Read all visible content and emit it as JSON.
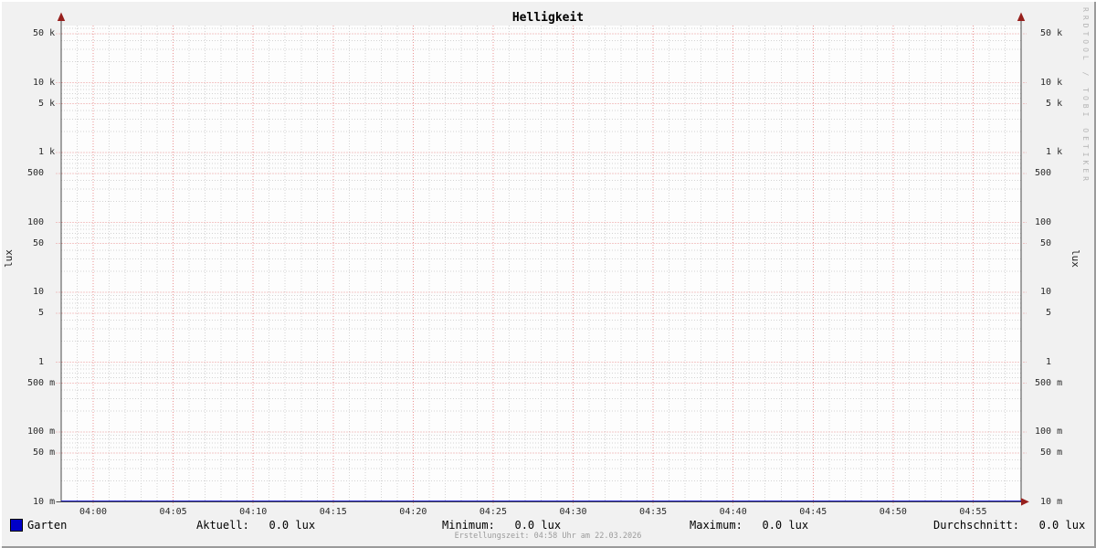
{
  "title": "Helligkeit",
  "watermark": "RRDTOOL / TOBI OETIKER",
  "chart_data": {
    "type": "line",
    "title": "Helligkeit",
    "ylabel_left": "lux",
    "ylabel_right": "lux",
    "yscale": "log",
    "ylim": [
      0.01,
      60000
    ],
    "grid": "minor gray dotted + major red dotted, on",
    "legend_position": "bottom",
    "y_ticks": [
      {
        "value": 50000,
        "label": " 50 k"
      },
      {
        "value": 10000,
        "label": " 10 k"
      },
      {
        "value": 5000,
        "label": "  5 k"
      },
      {
        "value": 1000,
        "label": "  1 k"
      },
      {
        "value": 500,
        "label": "500"
      },
      {
        "value": 100,
        "label": "100"
      },
      {
        "value": 50,
        "label": " 50"
      },
      {
        "value": 10,
        "label": " 10"
      },
      {
        "value": 5,
        "label": "  5"
      },
      {
        "value": 1,
        "label": "  1"
      },
      {
        "value": 0.5,
        "label": "500 m"
      },
      {
        "value": 0.1,
        "label": "100 m"
      },
      {
        "value": 0.05,
        "label": " 50 m"
      },
      {
        "value": 0.01,
        "label": " 10 m"
      }
    ],
    "x_ticks": [
      "04:00",
      "04:05",
      "04:10",
      "04:15",
      "04:20",
      "04:25",
      "04:30",
      "04:35",
      "04:40",
      "04:45",
      "04:50",
      "04:55"
    ],
    "x_minor_gridline_minutes": 1,
    "x_major_gridline_minutes": 5,
    "series": [
      {
        "name": "Garten",
        "color": "#0000c8",
        "unit": "lux",
        "constant_value": 0.0,
        "aktuell": 0.0,
        "minimum": 0.0,
        "maximum": 0.0,
        "durchschnitt": 0.0
      }
    ]
  },
  "legend": {
    "series_label": "Garten",
    "aktuell": "Aktuell:   0.0 lux",
    "minimum": "Minimum:   0.0 lux",
    "maximum": "Maximum:   0.0 lux",
    "durchschnitt": "Durchschnitt:   0.0 lux"
  },
  "footer": {
    "creation_time": "Erstellungszeit: 04:58 Uhr am 22.03.2026"
  },
  "colors": {
    "background": "#f1f1f1",
    "canvas": "#fdfdfd",
    "grid_minor": "#d3d3d3",
    "grid_major": "#ea9393",
    "axis": "#4a4a4a",
    "arrow": "#97201d",
    "series_garten": "#0000c8",
    "tick_text": "#2b2b2b",
    "footer_text": "#9b9b9b",
    "watermark_text": "#b5b5b5"
  }
}
